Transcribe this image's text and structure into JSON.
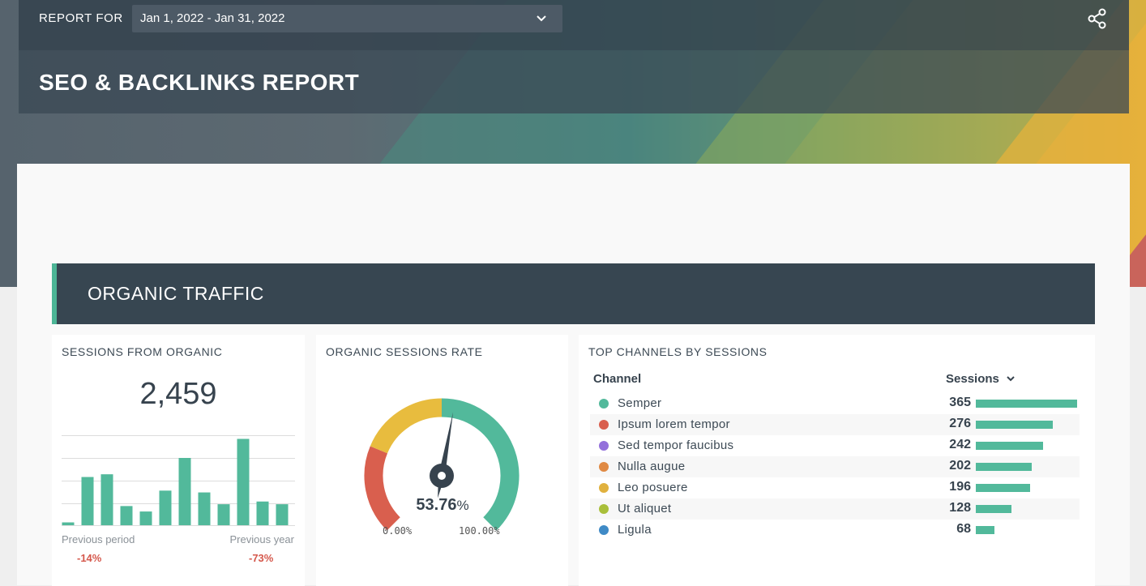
{
  "header": {
    "report_for_label": "REPORT FOR",
    "date_range": "Jan 1, 2022 - Jan 31, 2022",
    "title": "SEO & BACKLINKS REPORT"
  },
  "section": {
    "title": "ORGANIC TRAFFIC"
  },
  "sessions_card": {
    "title": "SESSIONS FROM ORGANIC",
    "value": "2,459",
    "previous_period_label": "Previous period",
    "previous_period_value": "-14%",
    "previous_year_label": "Previous year",
    "previous_year_value": "-73%",
    "bar_values": [
      4,
      54,
      57,
      22,
      16,
      39,
      75,
      37,
      24,
      96,
      27,
      24
    ],
    "bar_max": 100,
    "bar_color": "#52b99b"
  },
  "rate_card": {
    "title": "ORGANIC SESSIONS RATE",
    "value": "53.76",
    "unit": "%",
    "min_label": "0.00%",
    "max_label": "100.00%",
    "value_pct": 53.76,
    "colors": {
      "low": "#d95f4e",
      "mid": "#e8bc3e",
      "high": "#52b99b"
    }
  },
  "channels_card": {
    "title": "TOP CHANNELS BY SESSIONS",
    "col_channel": "Channel",
    "col_sessions": "Sessions",
    "rows": [
      {
        "name": "Semper",
        "sessions": "365",
        "value": 365,
        "color": "#52b99b"
      },
      {
        "name": "Ipsum lorem tempor",
        "sessions": "276",
        "value": 276,
        "color": "#d95f4e"
      },
      {
        "name": "Sed tempor faucibus",
        "sessions": "242",
        "value": 242,
        "color": "#9370db"
      },
      {
        "name": "Nulla augue",
        "sessions": "202",
        "value": 202,
        "color": "#e08a44"
      },
      {
        "name": "Leo posuere",
        "sessions": "196",
        "value": 196,
        "color": "#e0b13e"
      },
      {
        "name": "Ut aliquet",
        "sessions": "128",
        "value": 128,
        "color": "#a9bf3a"
      },
      {
        "name": "Ligula",
        "sessions": "68",
        "value": 68,
        "color": "#3f8ac6"
      }
    ],
    "bar_color": "#52b99b"
  }
}
